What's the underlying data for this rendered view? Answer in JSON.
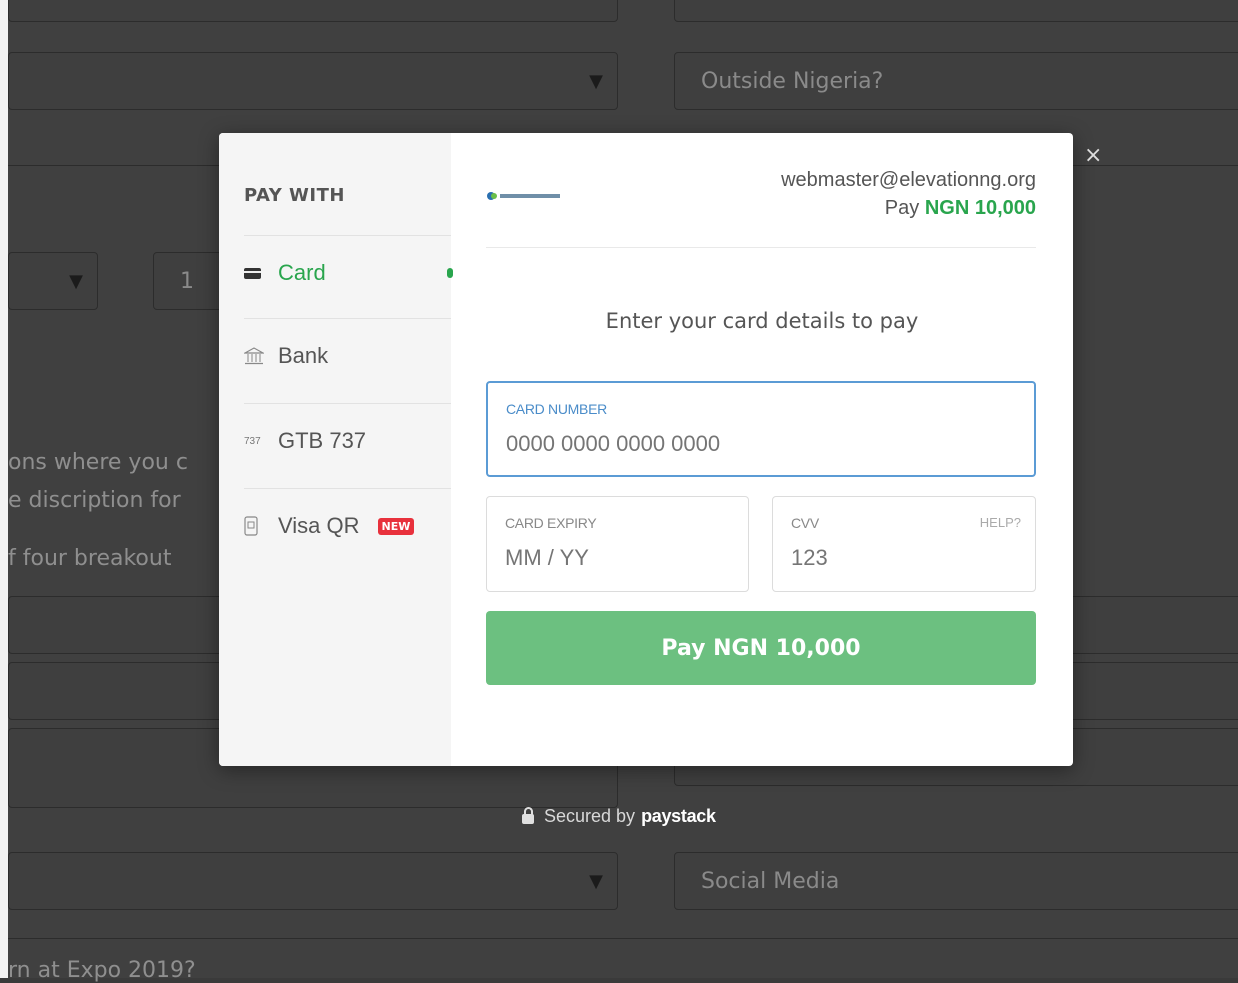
{
  "background": {
    "country_placeholder": "Outside Nigeria?",
    "quantity_value": "1",
    "source_value": "Social Media",
    "text_line_1": "ons where you c",
    "text_line_2": "e discription for",
    "text_line_3": "f four breakout",
    "text_line_4": "rn at Expo  2019?"
  },
  "sidebar": {
    "title": "PAY WITH",
    "items": [
      {
        "label": "Card",
        "icon": "card-icon"
      },
      {
        "label": "Bank",
        "icon": "bank-icon"
      },
      {
        "label": "GTB 737",
        "icon": "ussd-icon",
        "icon_text": "737"
      },
      {
        "label": "Visa QR",
        "icon": "qr-phone-icon",
        "badge": "NEW"
      }
    ]
  },
  "header": {
    "email": "webmaster@elevationng.org",
    "pay_prefix": "Pay ",
    "amount": "NGN 10,000"
  },
  "form": {
    "prompt": "Enter your card details to pay",
    "card_number_label": "CARD NUMBER",
    "card_number_placeholder": "0000 0000 0000 0000",
    "expiry_label": "CARD EXPIRY",
    "expiry_placeholder": "MM / YY",
    "cvv_label": "CVV",
    "cvv_help": "HELP?",
    "cvv_placeholder": "123",
    "pay_button": "Pay NGN 10,000"
  },
  "footer": {
    "secured_by": "Secured by",
    "brand": "paystack"
  },
  "close_glyph": "×",
  "colors": {
    "accent": "#29a54d",
    "button": "#6cc080",
    "focus": "#5b9bd5",
    "badge": "#e8313c"
  }
}
